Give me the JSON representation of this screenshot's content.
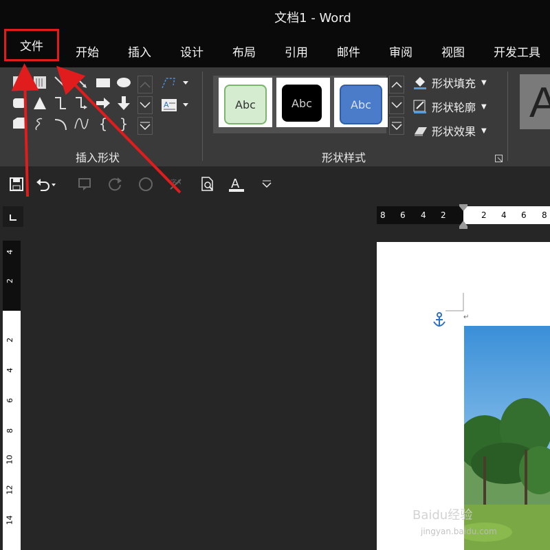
{
  "window": {
    "title": "文档1  -  Word"
  },
  "menu": {
    "tabs": [
      {
        "label": "文件"
      },
      {
        "label": "开始"
      },
      {
        "label": "插入"
      },
      {
        "label": "设计"
      },
      {
        "label": "布局"
      },
      {
        "label": "引用"
      },
      {
        "label": "邮件"
      },
      {
        "label": "审阅"
      },
      {
        "label": "视图"
      },
      {
        "label": "开发工具"
      }
    ]
  },
  "ribbon": {
    "insert_shapes_label": "插入形状",
    "shape_styles_label": "形状样式",
    "styles": [
      {
        "label": "Abc",
        "bg": "#d5ecd1",
        "border": "#79b56b",
        "color": "#333333"
      },
      {
        "label": "Abc",
        "bg": "#000000",
        "border": "#000000",
        "color": "#cfcfcf"
      },
      {
        "label": "Abc",
        "bg": "#4a7cc9",
        "border": "#2e5ea8",
        "color": "#d8e4f5"
      }
    ],
    "commands": [
      {
        "label": "形状填充"
      },
      {
        "label": "形状轮廓"
      },
      {
        "label": "形状效果"
      }
    ],
    "big_text_preview": "A"
  },
  "rulers": {
    "horizontal_left": [
      "8",
      "6",
      "4",
      "2"
    ],
    "horizontal_right": [
      "2",
      "4",
      "6",
      "8"
    ],
    "vertical": [
      "4",
      "2",
      "2",
      "4",
      "6",
      "8",
      "10",
      "12",
      "14"
    ]
  },
  "document": {
    "paragraph_mark": "↵"
  },
  "watermark": {
    "brand": "Baidu经验",
    "url": "jingyan.baidu.com"
  },
  "colors": {
    "annotation_red": "#e11c1c",
    "accent_blue": "#3d7ed8"
  }
}
